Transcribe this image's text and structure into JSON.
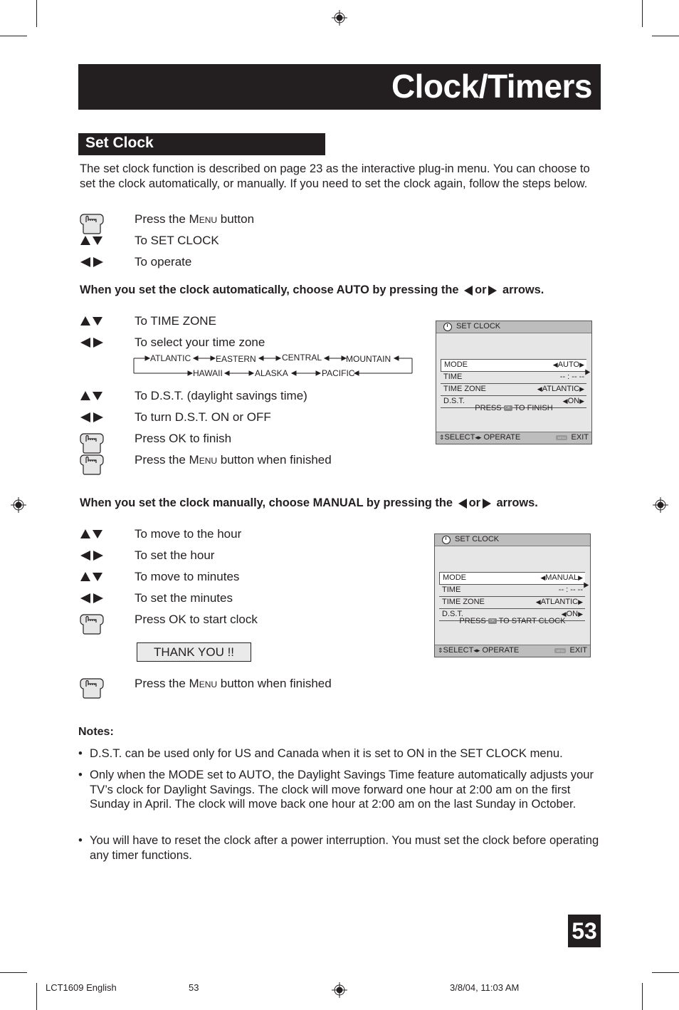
{
  "header": {
    "title": "Clock/Timers"
  },
  "section": {
    "title": "Set Clock"
  },
  "intro": "The set clock function is described on page 23 as the interactive plug-in menu. You can choose to set the clock automatically, or manually. If you need to set the clock again, follow the steps below.",
  "steps_intro": [
    {
      "icon": "hand-press-icon",
      "pre": "Press the ",
      "sc": "Menu",
      "post": " button"
    },
    {
      "icon": "up-down-arrows-icon",
      "text": "To SET CLOCK"
    },
    {
      "icon": "left-right-arrows-icon",
      "text": "To operate"
    }
  ],
  "auto_heading": {
    "pre": "When you set the clock automatically, choose AUTO by pressing the",
    "mid": "or",
    "post": "arrows."
  },
  "steps_auto": [
    {
      "icon": "up-down-arrows-icon",
      "text": "To TIME ZONE"
    },
    {
      "icon": "left-right-arrows-icon",
      "text": "To select your time zone"
    },
    {
      "icon": "up-down-arrows-icon",
      "text": "To D.S.T. (daylight savings time)"
    },
    {
      "icon": "left-right-arrows-icon",
      "text": "To turn D.S.T. ON or OFF"
    },
    {
      "icon": "hand-press-icon",
      "text": "Press OK to finish"
    },
    {
      "icon": "hand-press-icon",
      "pre": "Press the ",
      "sc": "Menu",
      "post": " button when finished"
    }
  ],
  "time_zones": {
    "top": [
      "ATLANTIC",
      "EASTERN",
      "CENTRAL",
      "MOUNTAIN"
    ],
    "bottom": [
      "HAWAII",
      "ALASKA",
      "PACIFIC"
    ]
  },
  "osd_auto": {
    "title": "SET CLOCK",
    "rows": [
      {
        "key": "MODE",
        "value": "AUTO",
        "arrows": true
      },
      {
        "key": "TIME",
        "value": "-- : -- --",
        "arrows": false
      },
      {
        "key": "TIME ZONE",
        "value": "ATLANTIC",
        "arrows": true
      },
      {
        "key": "D.S.T.",
        "value": "ON",
        "arrows": true
      }
    ],
    "press_pre": "PRESS",
    "ok_label": "OK",
    "press_post": "TO FINISH",
    "footer_left": "SELECT",
    "footer_op": "OPERATE",
    "menu_label": "MENU",
    "footer_right": "EXIT"
  },
  "manual_heading": {
    "pre": "When you set the clock manually, choose MANUAL by pressing the",
    "mid": "or",
    "post": "arrows."
  },
  "steps_manual": [
    {
      "icon": "up-down-arrows-icon",
      "text": "To move to the hour"
    },
    {
      "icon": "left-right-arrows-icon",
      "text": "To set the hour"
    },
    {
      "icon": "up-down-arrows-icon",
      "text": "To move to minutes"
    },
    {
      "icon": "left-right-arrows-icon",
      "text": "To set the minutes"
    },
    {
      "icon": "hand-press-icon",
      "text": "Press OK to start clock"
    }
  ],
  "thank_you": "THANK YOU !!",
  "step_final": {
    "icon": "hand-press-icon",
    "pre": "Press the ",
    "sc": "Menu",
    "post": " button when finished"
  },
  "osd_manual": {
    "title": "SET CLOCK",
    "rows": [
      {
        "key": "MODE",
        "value": "MANUAL",
        "arrows": true
      },
      {
        "key": "TIME",
        "value": "-- : -- --",
        "arrows": false
      },
      {
        "key": "TIME ZONE",
        "value": "ATLANTIC",
        "arrows": true
      },
      {
        "key": "D.S.T.",
        "value": "ON",
        "arrows": true
      }
    ],
    "press_pre": "PRESS",
    "ok_label": "OK",
    "press_post": "TO START CLOCK",
    "footer_left": "SELECT",
    "footer_op": "OPERATE",
    "menu_label": "MENU",
    "footer_right": "EXIT"
  },
  "notes": {
    "title": "Notes:",
    "items": [
      "D.S.T. can be used only for US and Canada when it is set to ON in the SET CLOCK menu.",
      "Only when the MODE set to AUTO, the Daylight Savings Time feature automatically adjusts your TV’s clock for Daylight Savings. The clock will move forward one hour at 2:00 am on the first Sunday in April. The clock will move back one hour at 2:00 am on the last Sunday in October.",
      "You will have to reset the clock after a power interruption. You must set the clock before operating any timer functions."
    ]
  },
  "page_number": "53",
  "footer": {
    "doc": "LCT1609 English",
    "page": "53",
    "date": "3/8/04, 11:03 AM"
  },
  "colors": {
    "ink": "#231f20",
    "osd_bg": "#e6e6e6",
    "osd_bar": "#bdbdbd"
  }
}
